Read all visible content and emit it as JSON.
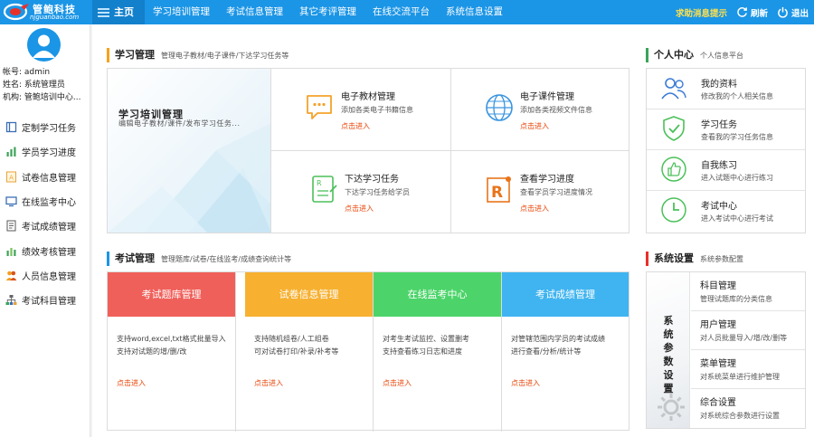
{
  "brand": {
    "name": "管鲍科技",
    "url": "njguanbao.com",
    "colors": {
      "primary": "#1b95e6",
      "accent_orange": "#f7a21b",
      "accent_red": "#e8460a"
    }
  },
  "topnav": {
    "items": [
      {
        "label": "主页",
        "icon": "menu-icon"
      },
      {
        "label": "学习培训管理"
      },
      {
        "label": "考试信息管理"
      },
      {
        "label": "其它考评管理"
      },
      {
        "label": "在线交流平台"
      },
      {
        "label": "系统信息设置"
      }
    ],
    "message_tip": "求助消息提示",
    "refresh": "刷新",
    "logout": "退出"
  },
  "user": {
    "account": "帐号: admin",
    "name": "姓名: 系统管理员",
    "org": "机构: 管鲍培训中心..."
  },
  "sidebar": {
    "items": [
      {
        "label": "定制学习任务",
        "icon": "book-icon"
      },
      {
        "label": "学员学习进度",
        "icon": "bar-chart-icon"
      },
      {
        "label": "试卷信息管理",
        "icon": "paper-icon"
      },
      {
        "label": "在线监考中心",
        "icon": "monitor-icon"
      },
      {
        "label": "考试成绩管理",
        "icon": "score-icon"
      },
      {
        "label": "绩效考核管理",
        "icon": "chart-icon"
      },
      {
        "label": "人员信息管理",
        "icon": "users-icon"
      },
      {
        "label": "考试科目管理",
        "icon": "org-icon"
      }
    ]
  },
  "study": {
    "title": "学习管理",
    "subtitle": "管理电子教材/电子课件/下达学习任务等",
    "banner_title": "学习培训管理",
    "banner_sub": "编辑电子教材/课件/发布学习任务...",
    "cells": [
      {
        "title": "电子教材管理",
        "desc": "添加各类电子书籍信息",
        "enter": "点击进入"
      },
      {
        "title": "电子课件管理",
        "desc": "添加各类视频文件信息",
        "enter": "点击进入"
      },
      {
        "title": "下达学习任务",
        "desc": "下达学习任务给学员",
        "enter": "点击进入"
      },
      {
        "title": "查看学习进度",
        "desc": "查看学员学习进度情况",
        "enter": "点击进入"
      }
    ]
  },
  "exam": {
    "title": "考试管理",
    "subtitle": "管理题库/试卷/在线监考/成绩查询统计等",
    "cols": [
      {
        "head": "考试题库管理",
        "color": "#f0605a",
        "desc1": "支持word,excel,txt格式批量导入",
        "desc2": "支持对试题的增/删/改",
        "enter": "点击进入"
      },
      {
        "head": "试卷信息管理",
        "color": "#f7b030",
        "desc1": "支持随机组卷/人工组卷",
        "desc2": "可对试卷打印/补录/补考等",
        "enter": "点击进入"
      },
      {
        "head": "在线监考中心",
        "color": "#4cd46a",
        "desc1": "对考生考试监控、设置删考",
        "desc2": "支持查看练习日志和进度",
        "enter": "点击进入"
      },
      {
        "head": "考试成绩管理",
        "color": "#3fb4f0",
        "desc1": "对管辖范围内学员的考试成绩",
        "desc2": "进行查看/分析/统计等",
        "enter": "点击进入"
      }
    ]
  },
  "personal": {
    "title": "个人中心",
    "subtitle": "个人信息平台",
    "items": [
      {
        "title": "我的资料",
        "desc": "修改我的个人相关信息",
        "icon": "profile-icon"
      },
      {
        "title": "学习任务",
        "desc": "查看我的学习任务信息",
        "icon": "shield-check-icon"
      },
      {
        "title": "自我练习",
        "desc": "进入试题中心进行练习",
        "icon": "thumbs-up-icon"
      },
      {
        "title": "考试中心",
        "desc": "进入考试中心进行考试",
        "icon": "clock-icon"
      }
    ]
  },
  "system": {
    "title": "系统设置",
    "subtitle": "系统参数配置",
    "vertical_label": "系统参数设置",
    "items": [
      {
        "title": "科目管理",
        "desc": "管理试题库的分类信息"
      },
      {
        "title": "用户管理",
        "desc": "对人员批量导入/增/改/删等"
      },
      {
        "title": "菜单管理",
        "desc": "对系统菜单进行维护管理"
      },
      {
        "title": "综合设置",
        "desc": "对系统综合参数进行设置"
      }
    ]
  }
}
